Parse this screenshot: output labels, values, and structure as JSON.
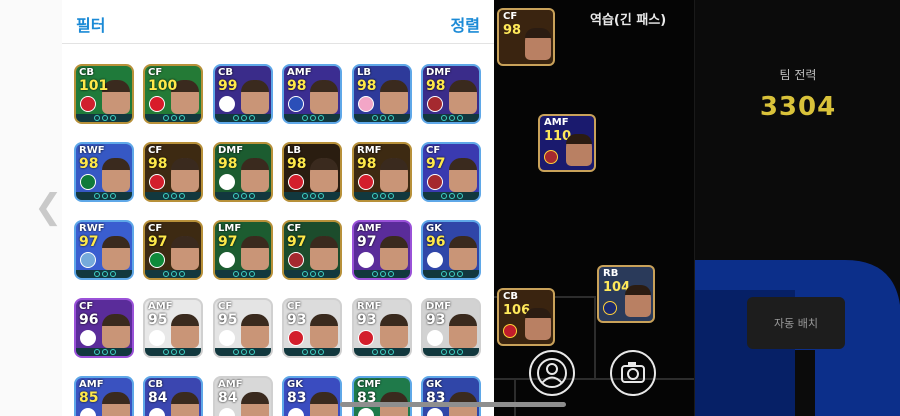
{
  "header": {
    "filter_label": "필터",
    "sort_label": "정렬"
  },
  "nav": {
    "back_glyph": "❮"
  },
  "cards": [
    {
      "pos": "CB",
      "ovr": "101",
      "pos_color": "#ffffff",
      "ovr_color": "#ffe94a",
      "border": "#b8913a",
      "bg": "#1f7a3a",
      "badge": "#d01f2e"
    },
    {
      "pos": "CF",
      "ovr": "100",
      "pos_color": "#ffffff",
      "ovr_color": "#ffe94a",
      "border": "#b8913a",
      "bg": "#247a36",
      "badge": "#d81c2a"
    },
    {
      "pos": "CB",
      "ovr": "99",
      "pos_color": "#ffffff",
      "ovr_color": "#ffe94a",
      "border": "#5fa8e8",
      "bg": "#3a2c8a",
      "badge": "#ffffff"
    },
    {
      "pos": "AMF",
      "ovr": "98",
      "pos_color": "#ffffff",
      "ovr_color": "#ffe94a",
      "border": "#5fa8e8",
      "bg": "#3b2d91",
      "badge": "#2b4fb8"
    },
    {
      "pos": "LB",
      "ovr": "98",
      "pos_color": "#ffffff",
      "ovr_color": "#ffe94a",
      "border": "#5fa8e8",
      "bg": "#2e3a9a",
      "badge": "#f3a6c7"
    },
    {
      "pos": "DMF",
      "ovr": "98",
      "pos_color": "#ffffff",
      "ovr_color": "#ffe94a",
      "border": "#5fa8e8",
      "bg": "#3a2c8a",
      "badge": "#a5292f"
    },
    {
      "pos": "RWF",
      "ovr": "98",
      "pos_color": "#ffffff",
      "ovr_color": "#ffe94a",
      "border": "#5fa8e8",
      "bg": "#3658c4",
      "badge": "#0f7a3a"
    },
    {
      "pos": "CF",
      "ovr": "98",
      "pos_color": "#ffffff",
      "ovr_color": "#ffe94a",
      "border": "#b8913a",
      "bg": "#3d2a12",
      "badge": "#d31e2c"
    },
    {
      "pos": "DMF",
      "ovr": "98",
      "pos_color": "#ffffff",
      "ovr_color": "#ffe94a",
      "border": "#b8913a",
      "bg": "#1c5c30",
      "badge": "#ffffff"
    },
    {
      "pos": "LB",
      "ovr": "98",
      "pos_color": "#ffffff",
      "ovr_color": "#ffe94a",
      "border": "#b8913a",
      "bg": "#2a1d10",
      "badge": "#d31e2c"
    },
    {
      "pos": "RMF",
      "ovr": "98",
      "pos_color": "#ffffff",
      "ovr_color": "#ffe94a",
      "border": "#b8913a",
      "bg": "#3d2a12",
      "badge": "#d31e2c"
    },
    {
      "pos": "CF",
      "ovr": "97",
      "pos_color": "#ffffff",
      "ovr_color": "#ffe94a",
      "border": "#5fa8e8",
      "bg": "#3a3ab0",
      "badge": "#a5292f"
    },
    {
      "pos": "RWF",
      "ovr": "97",
      "pos_color": "#ffffff",
      "ovr_color": "#ffe94a",
      "border": "#5fa8e8",
      "bg": "#3a5ed0",
      "badge": "#75aadb"
    },
    {
      "pos": "CF",
      "ovr": "97",
      "pos_color": "#ffffff",
      "ovr_color": "#ffe94a",
      "border": "#b8913a",
      "bg": "#3d2a12",
      "badge": "#0f8a3a"
    },
    {
      "pos": "LMF",
      "ovr": "97",
      "pos_color": "#ffffff",
      "ovr_color": "#ffe94a",
      "border": "#b8913a",
      "bg": "#1c5c30",
      "badge": "#ffffff"
    },
    {
      "pos": "CF",
      "ovr": "97",
      "pos_color": "#ffffff",
      "ovr_color": "#ffe94a",
      "border": "#b8913a",
      "bg": "#1c4c2c",
      "badge": "#a5292f"
    },
    {
      "pos": "AMF",
      "ovr": "97",
      "pos_color": "#ffffff",
      "ovr_color": "#ffffff",
      "border": "#9a52d8",
      "bg": "#5a2c9a",
      "badge": "#ffffff"
    },
    {
      "pos": "GK",
      "ovr": "96",
      "pos_color": "#ffffff",
      "ovr_color": "#ffe94a",
      "border": "#5fa8e8",
      "bg": "#3046a8",
      "badge": "#ffffff"
    },
    {
      "pos": "CF",
      "ovr": "96",
      "pos_color": "#ffffff",
      "ovr_color": "#ffffff",
      "border": "#9a52d8",
      "bg": "#5a2c9a",
      "badge": "#ffffff"
    },
    {
      "pos": "AMF",
      "ovr": "95",
      "pos_color": "#ffffff",
      "ovr_color": "#ffffff",
      "border": "#d0d0d0",
      "bg": "#e8e8e8",
      "badge": "#ffffff"
    },
    {
      "pos": "CF",
      "ovr": "95",
      "pos_color": "#ffffff",
      "ovr_color": "#ffffff",
      "border": "#d0d0d0",
      "bg": "#e4e4e4",
      "badge": "#ffffff"
    },
    {
      "pos": "CF",
      "ovr": "93",
      "pos_color": "#ffffff",
      "ovr_color": "#ffffff",
      "border": "#d0d0d0",
      "bg": "#dcdcdc",
      "badge": "#d31e2c"
    },
    {
      "pos": "RMF",
      "ovr": "93",
      "pos_color": "#ffffff",
      "ovr_color": "#ffffff",
      "border": "#d0d0d0",
      "bg": "#d8d8d8",
      "badge": "#d31e2c"
    },
    {
      "pos": "DMF",
      "ovr": "93",
      "pos_color": "#ffffff",
      "ovr_color": "#ffffff",
      "border": "#d0d0d0",
      "bg": "#d2d2d2",
      "badge": "#ffffff"
    },
    {
      "pos": "AMF",
      "ovr": "85",
      "pos_color": "#ffffff",
      "ovr_color": "#ffe94a",
      "border": "#5fa8e8",
      "bg": "#3a52c0",
      "badge": "#ffffff"
    },
    {
      "pos": "CB",
      "ovr": "84",
      "pos_color": "#ffffff",
      "ovr_color": "#ffffff",
      "border": "#5fa8e8",
      "bg": "#3b46b0",
      "badge": "#ffffff"
    },
    {
      "pos": "AMF",
      "ovr": "84",
      "pos_color": "#ffffff",
      "ovr_color": "#ffffff",
      "border": "#d0d0d0",
      "bg": "#d8d8d8",
      "badge": "#ffffff"
    },
    {
      "pos": "GK",
      "ovr": "83",
      "pos_color": "#ffffff",
      "ovr_color": "#ffffff",
      "border": "#5fa8e8",
      "bg": "#3a4cc0",
      "badge": "#ffffff"
    },
    {
      "pos": "CMF",
      "ovr": "83",
      "pos_color": "#ffffff",
      "ovr_color": "#ffffff",
      "border": "#5fa8e8",
      "bg": "#1f7a4a",
      "badge": "#ffffff"
    },
    {
      "pos": "GK",
      "ovr": "83",
      "pos_color": "#ffffff",
      "ovr_color": "#ffffff",
      "border": "#5fa8e8",
      "bg": "#3046a8",
      "badge": "#ffffff"
    }
  ],
  "field": {
    "formation_label": "역습(긴 패스)",
    "players": [
      {
        "pos": "CF",
        "ovr": "98"
      },
      {
        "pos": "AMF",
        "ovr": "110"
      },
      {
        "pos": "RB",
        "ovr": "104"
      },
      {
        "pos": "CB",
        "ovr": "106"
      }
    ],
    "formation_icon": "person-icon",
    "camera_icon": "camera-icon"
  },
  "team": {
    "label": "팀 전력",
    "value": "3304",
    "auto_button": "자동 배치"
  },
  "colors": {
    "accent": "#1b8ad6",
    "team_value": "#d9c23a",
    "field_bg": "#050505"
  }
}
